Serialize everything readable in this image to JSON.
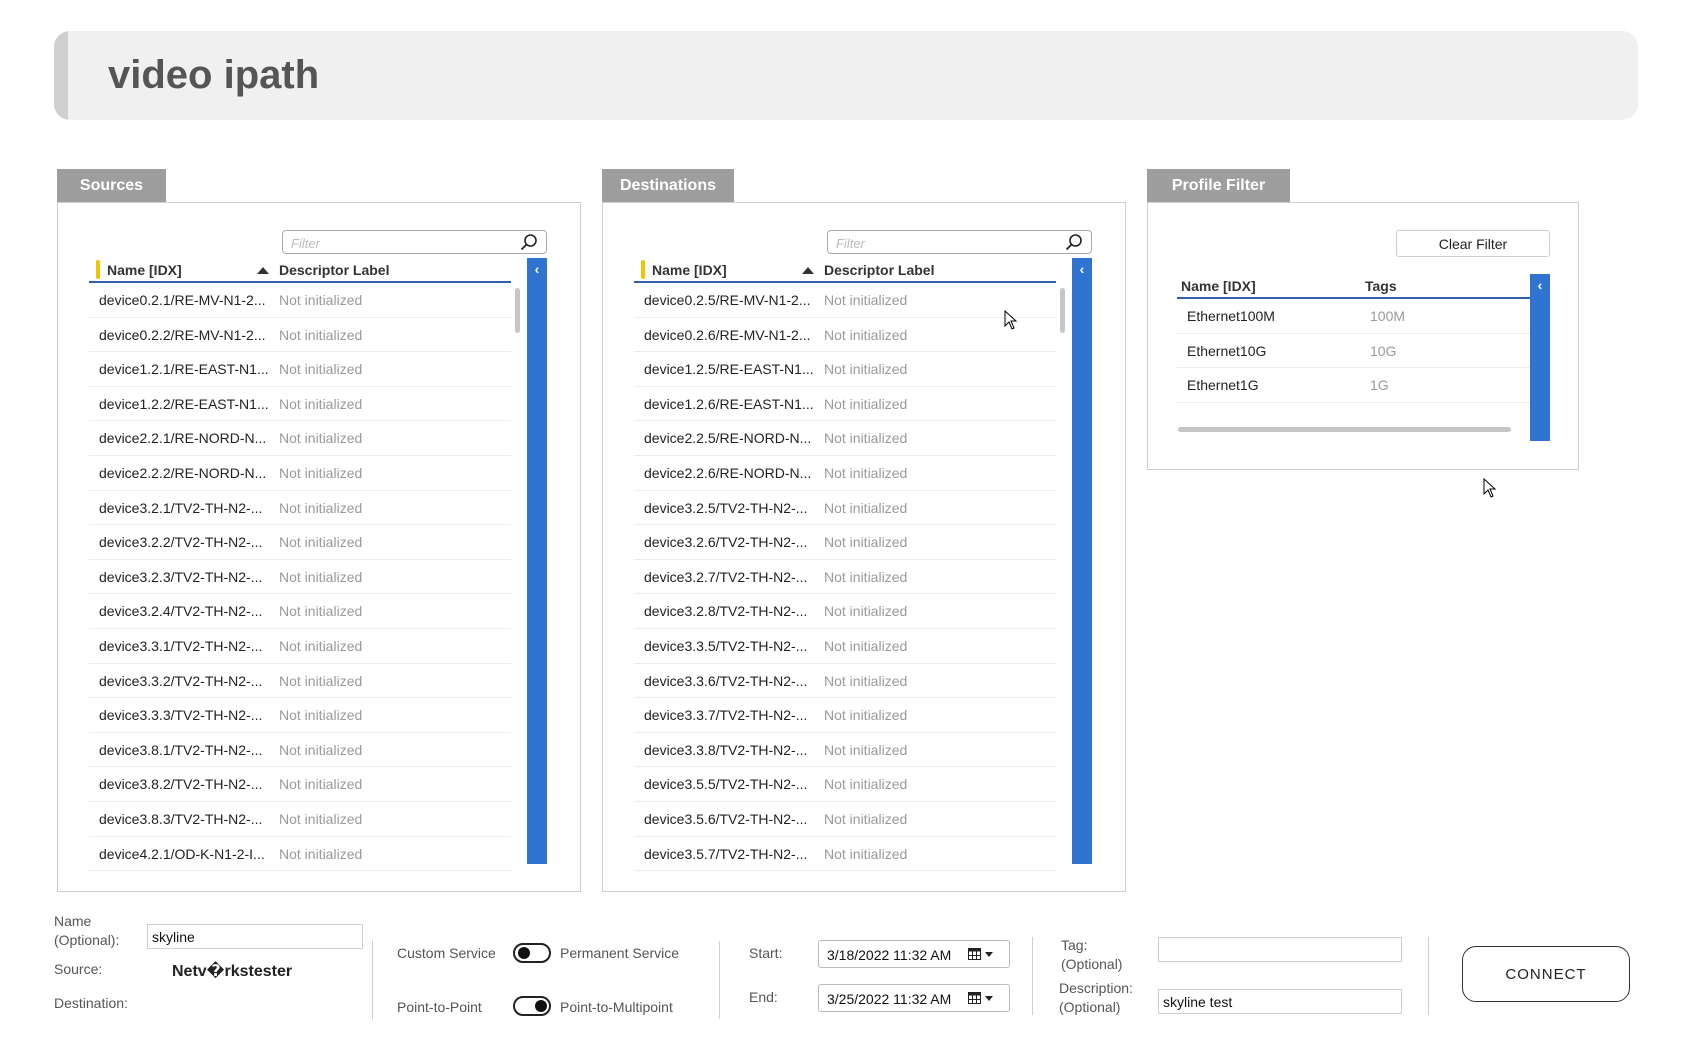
{
  "header": {
    "title": "video ipath"
  },
  "sources": {
    "tab": "Sources",
    "filter_placeholder": "Filter",
    "columns": {
      "name": "Name [IDX]",
      "label": "Descriptor Label"
    },
    "rows": [
      {
        "name": "device0.2.1/RE-MV-N1-2...",
        "label": "Not initialized"
      },
      {
        "name": "device0.2.2/RE-MV-N1-2...",
        "label": "Not initialized"
      },
      {
        "name": "device1.2.1/RE-EAST-N1...",
        "label": "Not initialized"
      },
      {
        "name": "device1.2.2/RE-EAST-N1...",
        "label": "Not initialized"
      },
      {
        "name": "device2.2.1/RE-NORD-N...",
        "label": "Not initialized"
      },
      {
        "name": "device2.2.2/RE-NORD-N...",
        "label": "Not initialized"
      },
      {
        "name": "device3.2.1/TV2-TH-N2-...",
        "label": "Not initialized"
      },
      {
        "name": "device3.2.2/TV2-TH-N2-...",
        "label": "Not initialized"
      },
      {
        "name": "device3.2.3/TV2-TH-N2-...",
        "label": "Not initialized"
      },
      {
        "name": "device3.2.4/TV2-TH-N2-...",
        "label": "Not initialized"
      },
      {
        "name": "device3.3.1/TV2-TH-N2-...",
        "label": "Not initialized"
      },
      {
        "name": "device3.3.2/TV2-TH-N2-...",
        "label": "Not initialized"
      },
      {
        "name": "device3.3.3/TV2-TH-N2-...",
        "label": "Not initialized"
      },
      {
        "name": "device3.8.1/TV2-TH-N2-...",
        "label": "Not initialized"
      },
      {
        "name": "device3.8.2/TV2-TH-N2-...",
        "label": "Not initialized"
      },
      {
        "name": "device3.8.3/TV2-TH-N2-...",
        "label": "Not initialized"
      },
      {
        "name": "device4.2.1/OD-K-N1-2-I...",
        "label": "Not initialized"
      }
    ]
  },
  "destinations": {
    "tab": "Destinations",
    "filter_placeholder": "Filter",
    "columns": {
      "name": "Name [IDX]",
      "label": "Descriptor Label"
    },
    "rows": [
      {
        "name": "device0.2.5/RE-MV-N1-2...",
        "label": "Not initialized"
      },
      {
        "name": "device0.2.6/RE-MV-N1-2...",
        "label": "Not initialized"
      },
      {
        "name": "device1.2.5/RE-EAST-N1...",
        "label": "Not initialized"
      },
      {
        "name": "device1.2.6/RE-EAST-N1...",
        "label": "Not initialized"
      },
      {
        "name": "device2.2.5/RE-NORD-N...",
        "label": "Not initialized"
      },
      {
        "name": "device2.2.6/RE-NORD-N...",
        "label": "Not initialized"
      },
      {
        "name": "device3.2.5/TV2-TH-N2-...",
        "label": "Not initialized"
      },
      {
        "name": "device3.2.6/TV2-TH-N2-...",
        "label": "Not initialized"
      },
      {
        "name": "device3.2.7/TV2-TH-N2-...",
        "label": "Not initialized"
      },
      {
        "name": "device3.2.8/TV2-TH-N2-...",
        "label": "Not initialized"
      },
      {
        "name": "device3.3.5/TV2-TH-N2-...",
        "label": "Not initialized"
      },
      {
        "name": "device3.3.6/TV2-TH-N2-...",
        "label": "Not initialized"
      },
      {
        "name": "device3.3.7/TV2-TH-N2-...",
        "label": "Not initialized"
      },
      {
        "name": "device3.3.8/TV2-TH-N2-...",
        "label": "Not initialized"
      },
      {
        "name": "device3.5.5/TV2-TH-N2-...",
        "label": "Not initialized"
      },
      {
        "name": "device3.5.6/TV2-TH-N2-...",
        "label": "Not initialized"
      },
      {
        "name": "device3.5.7/TV2-TH-N2-...",
        "label": "Not initialized"
      }
    ]
  },
  "profile_filter": {
    "tab": "Profile Filter",
    "clear_label": "Clear Filter",
    "columns": {
      "name": "Name [IDX]",
      "tags": "Tags"
    },
    "rows": [
      {
        "name": "Ethernet100M",
        "tags": "100M"
      },
      {
        "name": "Ethernet10G",
        "tags": "10G"
      },
      {
        "name": "Ethernet1G",
        "tags": "1G"
      }
    ]
  },
  "form": {
    "name_label_1": "Name",
    "name_label_2": "(Optional):",
    "name_value": "skyline",
    "source_label": "Source:",
    "source_value": "Netv�rkstester",
    "destination_label": "Destination:",
    "custom_service": "Custom Service",
    "permanent_service": "Permanent Service",
    "point_to_point": "Point-to-Point",
    "point_to_multipoint": "Point-to-Multipoint",
    "start_label": "Start:",
    "start_value": "3/18/2022 11:32 AM",
    "end_label": "End:",
    "end_value": "3/25/2022 11:32 AM",
    "tag_label_1": "Tag:",
    "tag_label_2": "(Optional)",
    "tag_value": "",
    "description_label_1": "Description:",
    "description_label_2": "(Optional)",
    "description_value": "skyline test",
    "connect_label": "CONNECT"
  },
  "icons": {
    "search": "search-icon",
    "key": "key-icon",
    "sort": "sort-ascending-icon",
    "collapse": "chevron-left-icon",
    "calendar": "calendar-icon",
    "cursor": "mouse-cursor-icon"
  },
  "colors": {
    "accent_blue": "#2f74d0",
    "header_underline": "#2e5fa8",
    "tab_gray": "#9e9e9e",
    "header_bg": "#f0f0f0"
  }
}
